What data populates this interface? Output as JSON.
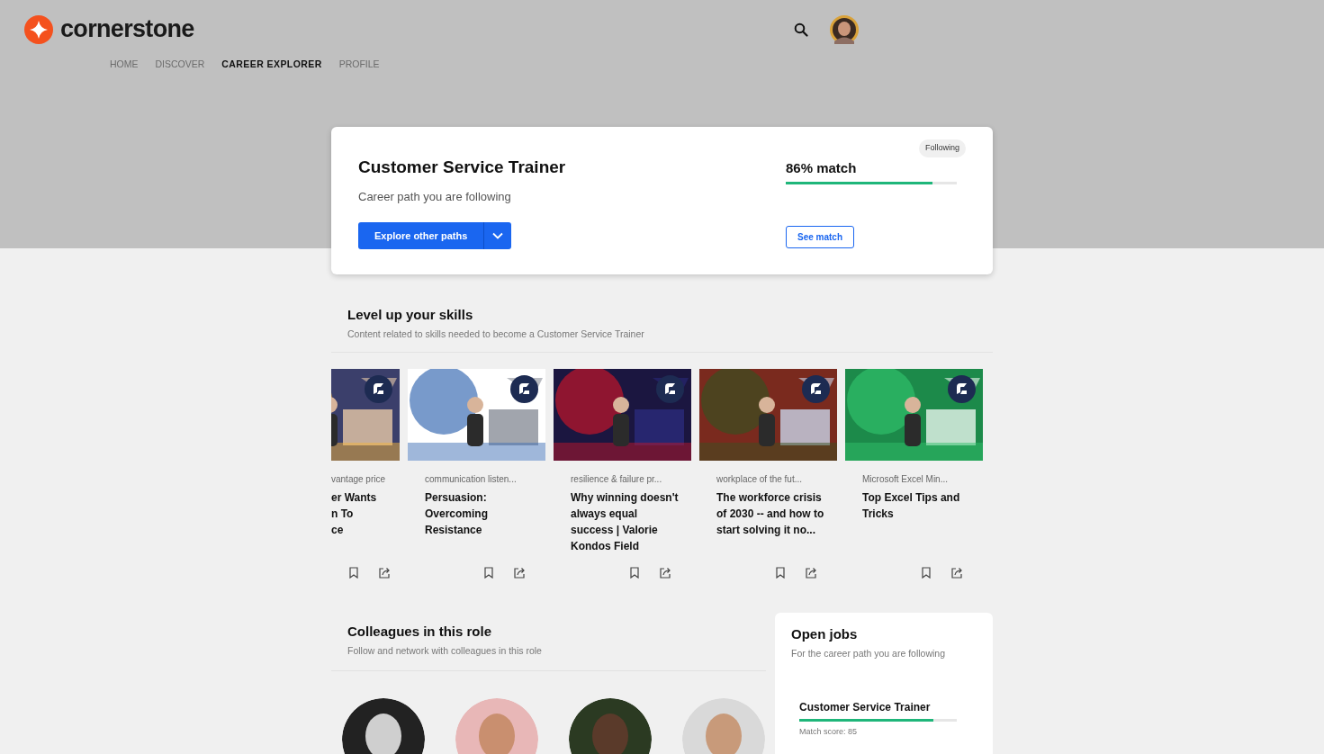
{
  "brand": {
    "name": "cornerstone"
  },
  "nav": [
    {
      "label": "HOME",
      "selected": false
    },
    {
      "label": "DISCOVER",
      "selected": false
    },
    {
      "label": "CAREER EXPLORER",
      "selected": true
    },
    {
      "label": "PROFILE",
      "selected": false
    }
  ],
  "career": {
    "title": "Customer Service Trainer",
    "subtitle": "Career path you are following",
    "primary_button": "Explore other paths",
    "badge": "Following",
    "match_label": "86% match",
    "level": 0.86,
    "secondary_button": "See match"
  },
  "skills": {
    "title": "Level up your skills",
    "subtitle": "Content related to skills needed to become a Customer Service Trainer",
    "items": [
      {
        "category": "vantage price",
        "title": "er Wants\nn To\nce"
      },
      {
        "category": "communication listen...",
        "title": "Persuasion: Overcoming Resistance"
      },
      {
        "category": "resilience & failure pr...",
        "title": "Why winning doesn't always equal success | Valorie Kondos Field"
      },
      {
        "category": "workplace of the fut...",
        "title": "The workforce crisis of 2030 -- and how to start solving it no..."
      },
      {
        "category": "Microsoft Excel Min...",
        "title": "Top Excel Tips and Tricks"
      }
    ]
  },
  "colleagues": {
    "title": "Colleagues in this role",
    "subtitle": "Follow and network with colleagues in this role"
  },
  "open_jobs": {
    "title": "Open jobs",
    "subtitle": "For the career path you are following",
    "jobs": [
      {
        "title": "Customer Service Trainer",
        "level": 0.85,
        "score": "Match score: 85"
      }
    ]
  }
}
